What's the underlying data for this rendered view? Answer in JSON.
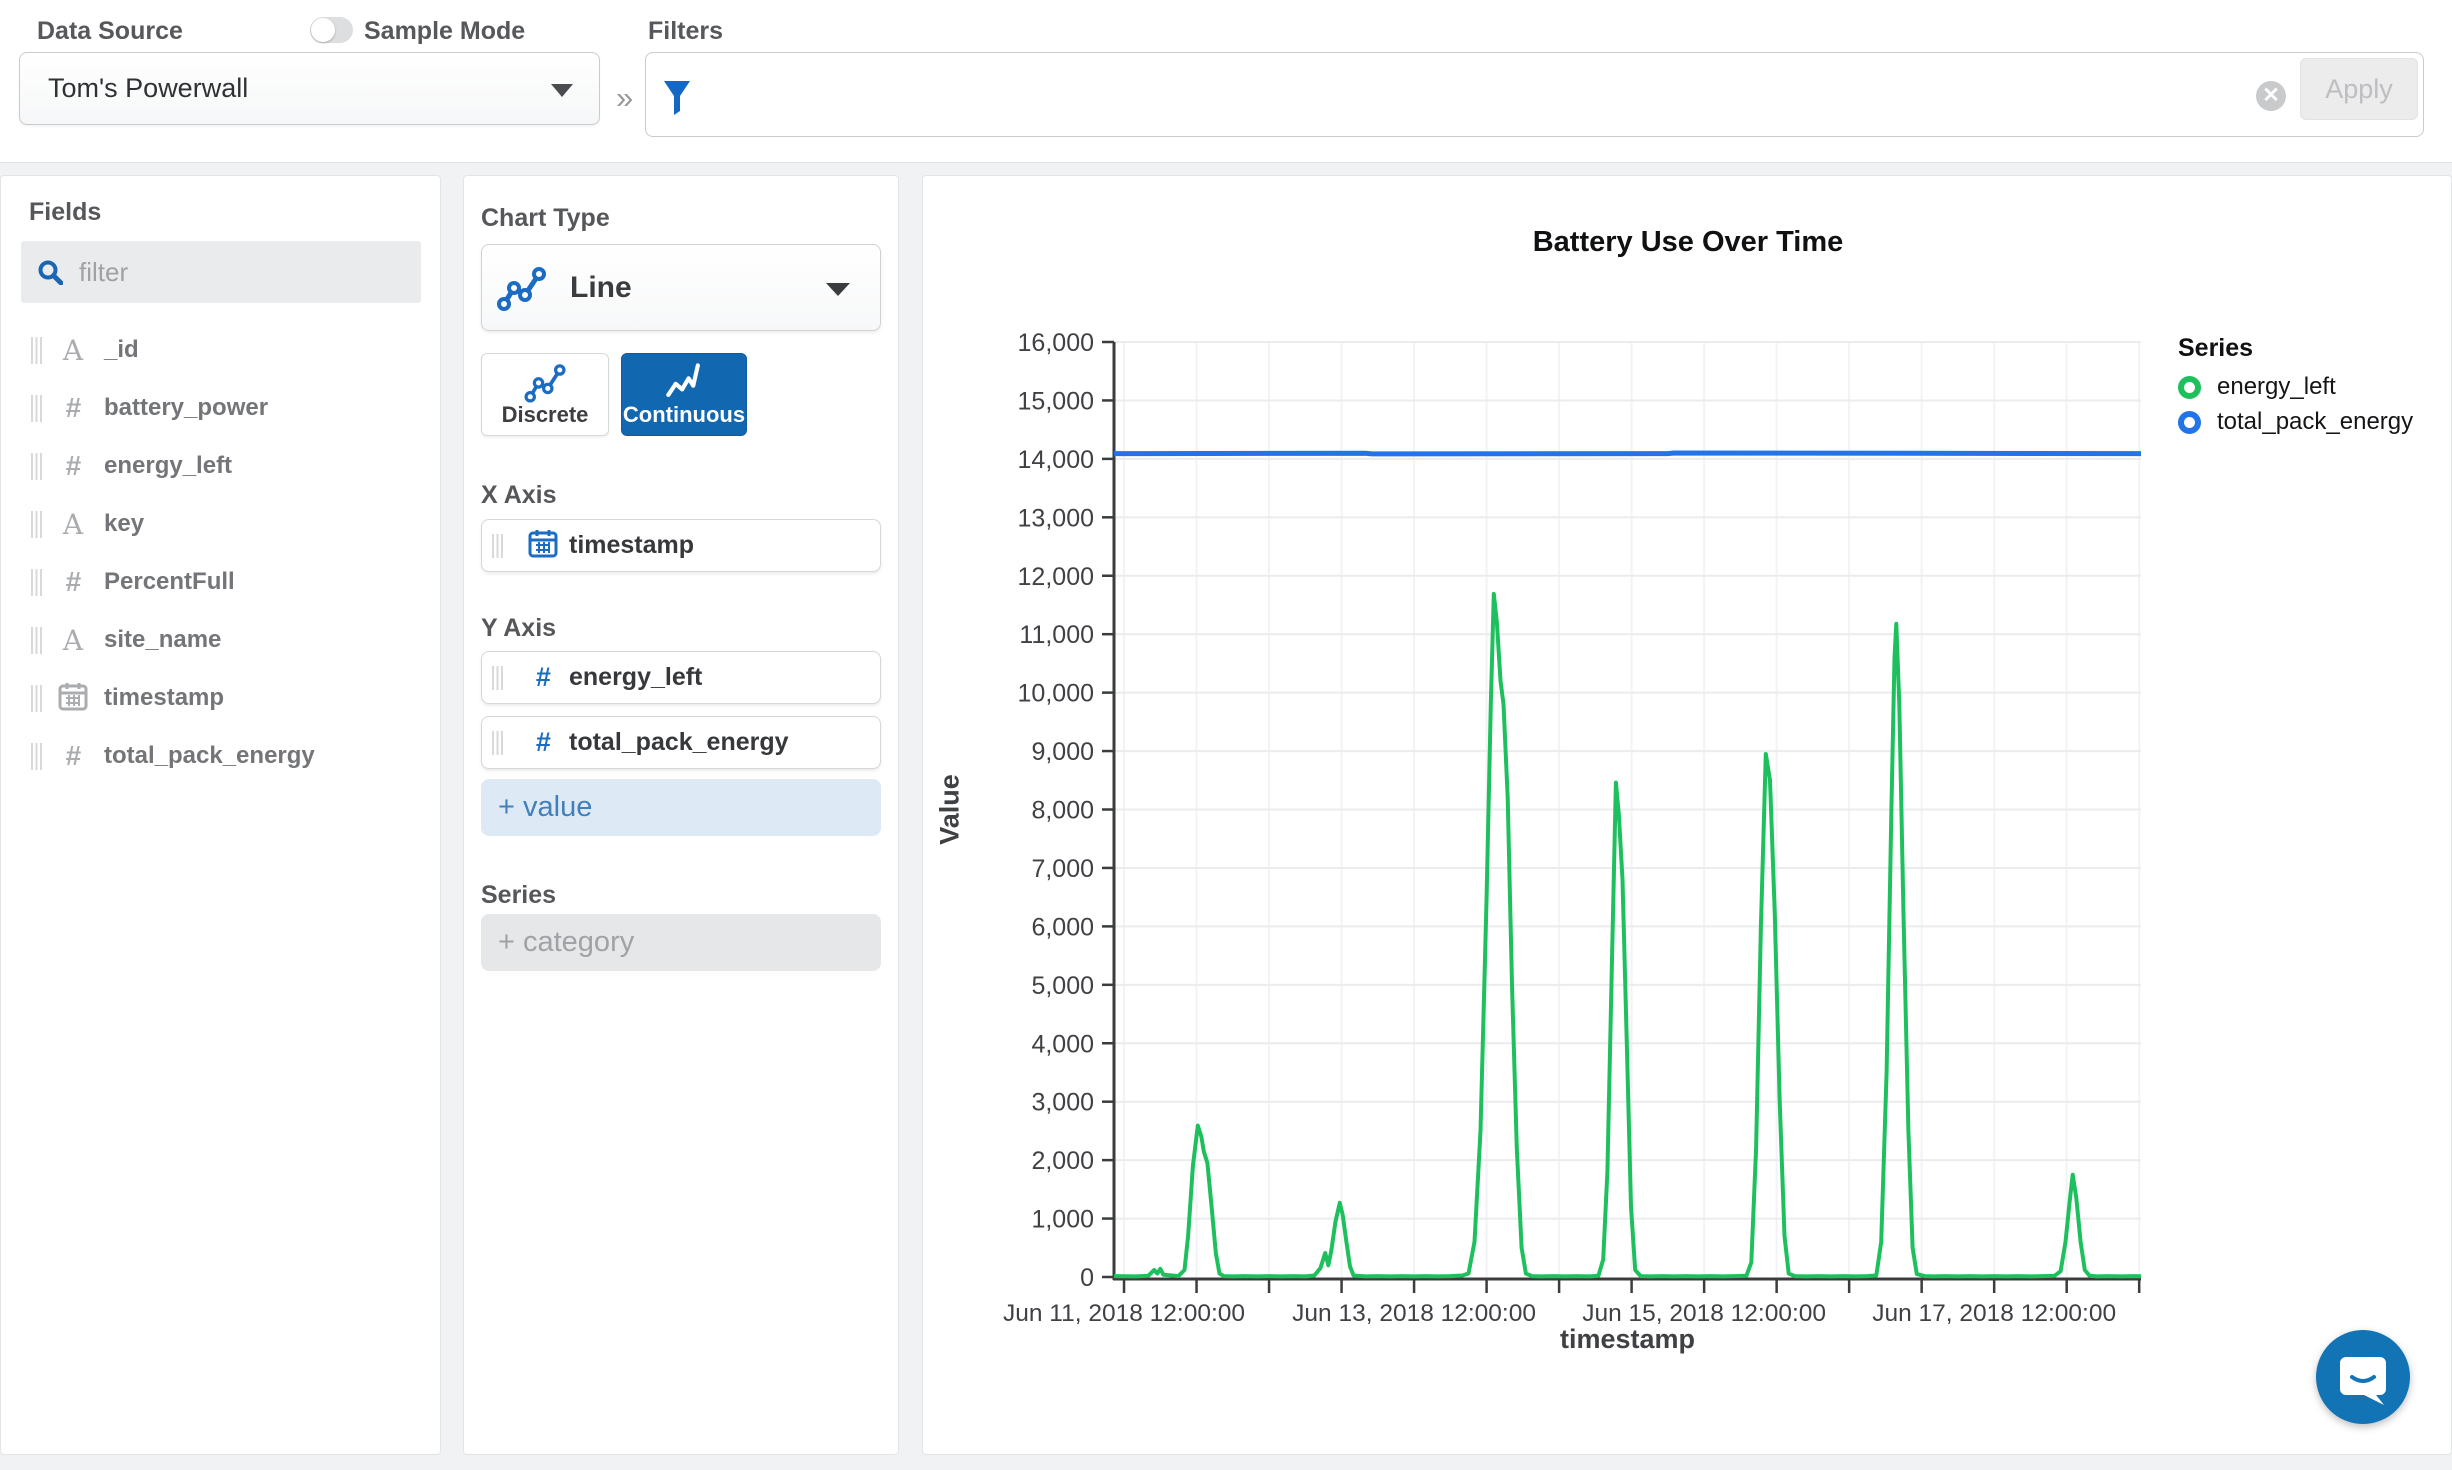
{
  "topbar": {
    "data_source_label": "Data Source",
    "data_source_value": "Tom's Powerwall",
    "sample_mode_label": "Sample Mode",
    "sample_mode_on": false,
    "filters_label": "Filters",
    "filter_value": "",
    "apply_label": "Apply",
    "collapse_chevron": "»",
    "clear_glyph": "✕"
  },
  "fields_panel": {
    "title": "Fields",
    "filter_placeholder": "filter",
    "fields": [
      {
        "name": "_id",
        "type": "string"
      },
      {
        "name": "battery_power",
        "type": "number"
      },
      {
        "name": "energy_left",
        "type": "number"
      },
      {
        "name": "key",
        "type": "string"
      },
      {
        "name": "PercentFull",
        "type": "number"
      },
      {
        "name": "site_name",
        "type": "string"
      },
      {
        "name": "timestamp",
        "type": "date"
      },
      {
        "name": "total_pack_energy",
        "type": "number"
      }
    ]
  },
  "encoding_panel": {
    "chart_type_label": "Chart Type",
    "chart_type_value": "Line",
    "discrete_label": "Discrete",
    "continuous_label": "Continuous",
    "continuous_selected": true,
    "x_axis_label": "X Axis",
    "x_axis_field": {
      "name": "timestamp",
      "type": "date"
    },
    "y_axis_label": "Y Axis",
    "y_axis_fields": [
      {
        "name": "energy_left",
        "type": "number"
      },
      {
        "name": "total_pack_energy",
        "type": "number"
      }
    ],
    "add_value_label": "+ value",
    "series_label": "Series",
    "add_category_label": "+ category"
  },
  "colors": {
    "energy_left": "#1ec05e",
    "total_pack_energy": "#2274e8",
    "axis": "#3a3c3e",
    "tick_label": "#3f4145",
    "grid_h": "#ebeced",
    "grid_v": "#f2f3f4"
  },
  "chart_data": {
    "type": "line",
    "title": "Battery Use Over Time",
    "xlabel": "timestamp",
    "ylabel": "Value",
    "legend_title": "Series",
    "ylim": [
      0,
      16000
    ],
    "ytick_step": 1000,
    "x_domain_hours": [
      -1.66,
      168.3
    ],
    "x_minor_tick_step_hours": 12,
    "x_major_ticks": [
      {
        "h": 0,
        "label": "Jun 11, 2018 12:00:00"
      },
      {
        "h": 48,
        "label": "Jun 13, 2018 12:00:00"
      },
      {
        "h": 96,
        "label": "Jun 15, 2018 12:00:00"
      },
      {
        "h": 144,
        "label": "Jun 17, 2018 12:00:00"
      }
    ],
    "series": [
      {
        "name": "energy_left",
        "points": [
          [
            -1.66,
            15
          ],
          [
            2,
            10
          ],
          [
            4,
            20
          ],
          [
            5,
            120
          ],
          [
            5.5,
            60
          ],
          [
            6,
            140
          ],
          [
            6.5,
            40
          ],
          [
            8,
            25
          ],
          [
            9,
            15
          ],
          [
            10,
            120
          ],
          [
            10.6,
            700
          ],
          [
            11.4,
            1900
          ],
          [
            12.2,
            2590
          ],
          [
            12.8,
            2400
          ],
          [
            13.2,
            2150
          ],
          [
            13.8,
            1950
          ],
          [
            14.5,
            1200
          ],
          [
            15.2,
            400
          ],
          [
            15.8,
            60
          ],
          [
            16.5,
            15
          ],
          [
            18,
            10
          ],
          [
            20,
            15
          ],
          [
            22,
            10
          ],
          [
            24,
            15
          ],
          [
            26,
            10
          ],
          [
            28,
            15
          ],
          [
            30,
            10
          ],
          [
            31.5,
            25
          ],
          [
            32.5,
            150
          ],
          [
            33.3,
            410
          ],
          [
            33.8,
            200
          ],
          [
            34.3,
            450
          ],
          [
            35,
            950
          ],
          [
            35.7,
            1270
          ],
          [
            36.2,
            1050
          ],
          [
            36.8,
            600
          ],
          [
            37.4,
            180
          ],
          [
            38,
            25
          ],
          [
            40,
            10
          ],
          [
            42,
            15
          ],
          [
            44,
            10
          ],
          [
            46,
            15
          ],
          [
            48,
            10
          ],
          [
            50,
            15
          ],
          [
            52,
            10
          ],
          [
            54,
            15
          ],
          [
            56,
            25
          ],
          [
            57,
            60
          ],
          [
            58,
            600
          ],
          [
            59,
            2500
          ],
          [
            60,
            6500
          ],
          [
            60.7,
            9800
          ],
          [
            61.2,
            11690
          ],
          [
            61.7,
            11200
          ],
          [
            62.3,
            10200
          ],
          [
            62.8,
            9800
          ],
          [
            63.5,
            8200
          ],
          [
            64.2,
            5000
          ],
          [
            65,
            2200
          ],
          [
            65.8,
            500
          ],
          [
            66.5,
            60
          ],
          [
            67.5,
            15
          ],
          [
            69,
            10
          ],
          [
            71,
            15
          ],
          [
            73,
            10
          ],
          [
            75,
            15
          ],
          [
            77,
            10
          ],
          [
            78.5,
            20
          ],
          [
            79.3,
            300
          ],
          [
            80,
            1800
          ],
          [
            80.7,
            5200
          ],
          [
            81.4,
            8460
          ],
          [
            81.9,
            7900
          ],
          [
            82.5,
            6800
          ],
          [
            83.2,
            4000
          ],
          [
            83.9,
            1200
          ],
          [
            84.6,
            120
          ],
          [
            85.5,
            15
          ],
          [
            87,
            10
          ],
          [
            89,
            15
          ],
          [
            91,
            10
          ],
          [
            93,
            15
          ],
          [
            95,
            10
          ],
          [
            97,
            15
          ],
          [
            99,
            10
          ],
          [
            101,
            15
          ],
          [
            103,
            20
          ],
          [
            103.8,
            250
          ],
          [
            104.6,
            2200
          ],
          [
            105.4,
            6000
          ],
          [
            106.2,
            8950
          ],
          [
            106.9,
            8500
          ],
          [
            107.7,
            6200
          ],
          [
            108.5,
            3000
          ],
          [
            109.3,
            700
          ],
          [
            110,
            60
          ],
          [
            111,
            15
          ],
          [
            113,
            10
          ],
          [
            115,
            15
          ],
          [
            117,
            10
          ],
          [
            119,
            15
          ],
          [
            121,
            10
          ],
          [
            123,
            15
          ],
          [
            124.5,
            25
          ],
          [
            125.3,
            600
          ],
          [
            126.2,
            3500
          ],
          [
            127,
            8000
          ],
          [
            127.5,
            10600
          ],
          [
            127.8,
            11180
          ],
          [
            128.3,
            9800
          ],
          [
            129,
            6200
          ],
          [
            129.8,
            2500
          ],
          [
            130.5,
            500
          ],
          [
            131.2,
            50
          ],
          [
            132.5,
            15
          ],
          [
            134,
            10
          ],
          [
            136,
            15
          ],
          [
            138,
            10
          ],
          [
            140,
            15
          ],
          [
            142,
            10
          ],
          [
            144,
            15
          ],
          [
            146,
            10
          ],
          [
            148,
            15
          ],
          [
            150,
            10
          ],
          [
            152,
            15
          ],
          [
            154,
            20
          ],
          [
            155,
            100
          ],
          [
            155.8,
            600
          ],
          [
            156.5,
            1300
          ],
          [
            157,
            1750
          ],
          [
            157.6,
            1350
          ],
          [
            158.3,
            600
          ],
          [
            159,
            120
          ],
          [
            159.8,
            20
          ],
          [
            161,
            10
          ],
          [
            163,
            15
          ],
          [
            165,
            10
          ],
          [
            167,
            15
          ],
          [
            168.3,
            12
          ]
        ]
      },
      {
        "name": "total_pack_energy",
        "points": [
          [
            -1.66,
            14090
          ],
          [
            40,
            14095
          ],
          [
            41,
            14085
          ],
          [
            90,
            14090
          ],
          [
            91,
            14100
          ],
          [
            168.3,
            14090
          ]
        ]
      }
    ]
  }
}
